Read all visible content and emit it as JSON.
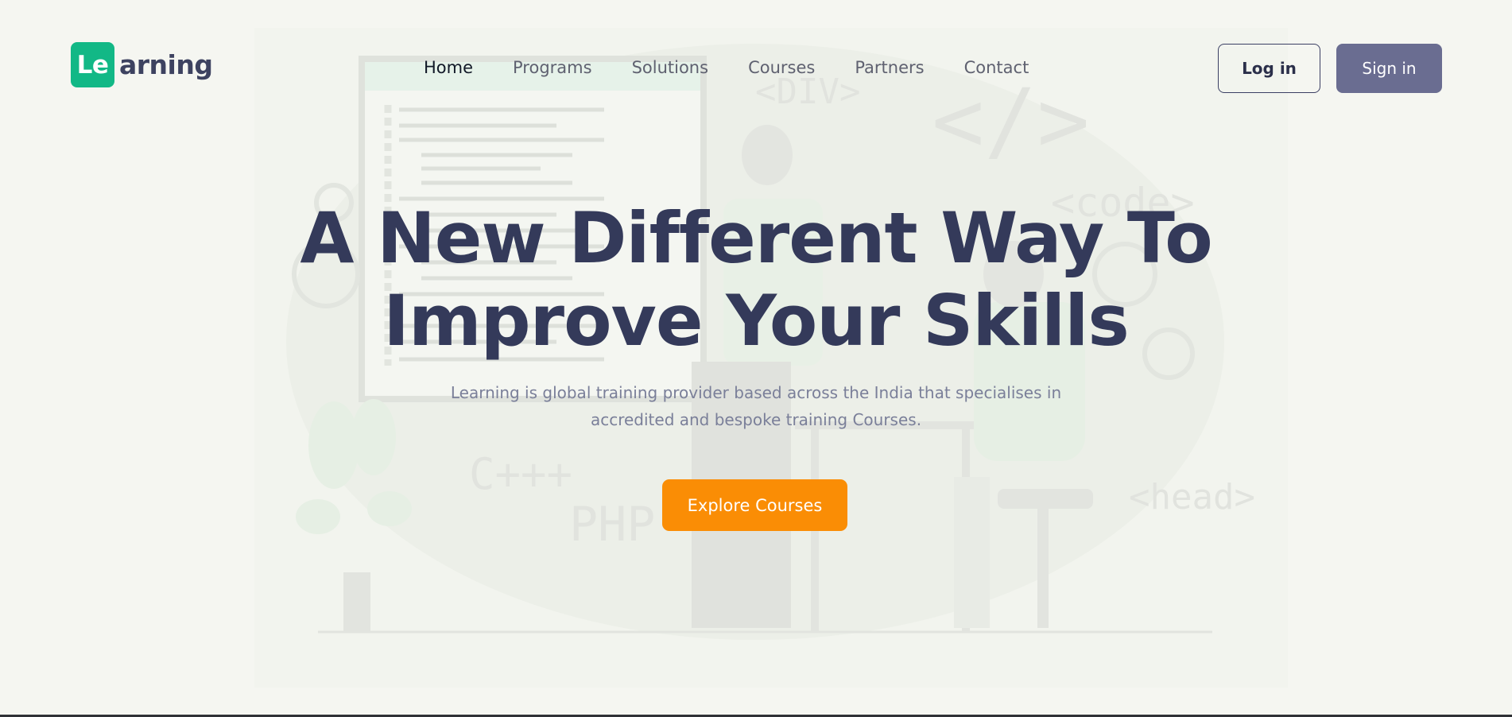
{
  "brand": {
    "logo_box": "Le",
    "logo_rest": "arning",
    "color": "#12b886"
  },
  "nav": {
    "items": [
      "Home",
      "Programs",
      "Solutions",
      "Courses",
      "Partners",
      "Contact"
    ],
    "active": "Home"
  },
  "auth": {
    "login_label": "Log in",
    "signin_label": "Sign in"
  },
  "hero": {
    "title_line1": "A New Different Way To",
    "title_line2": "Improve Your Skills",
    "subtitle_line1": "Learning is global training provider based across the India that specialises in",
    "subtitle_line2": "accredited and bespoke training Courses.",
    "cta_label": "Explore Courses",
    "cta_color": "#fa8d05"
  },
  "illustration": {
    "code_tags": [
      "<DIV>",
      "</>",
      "<code>",
      "C+++",
      "PHP",
      "<head>"
    ]
  }
}
